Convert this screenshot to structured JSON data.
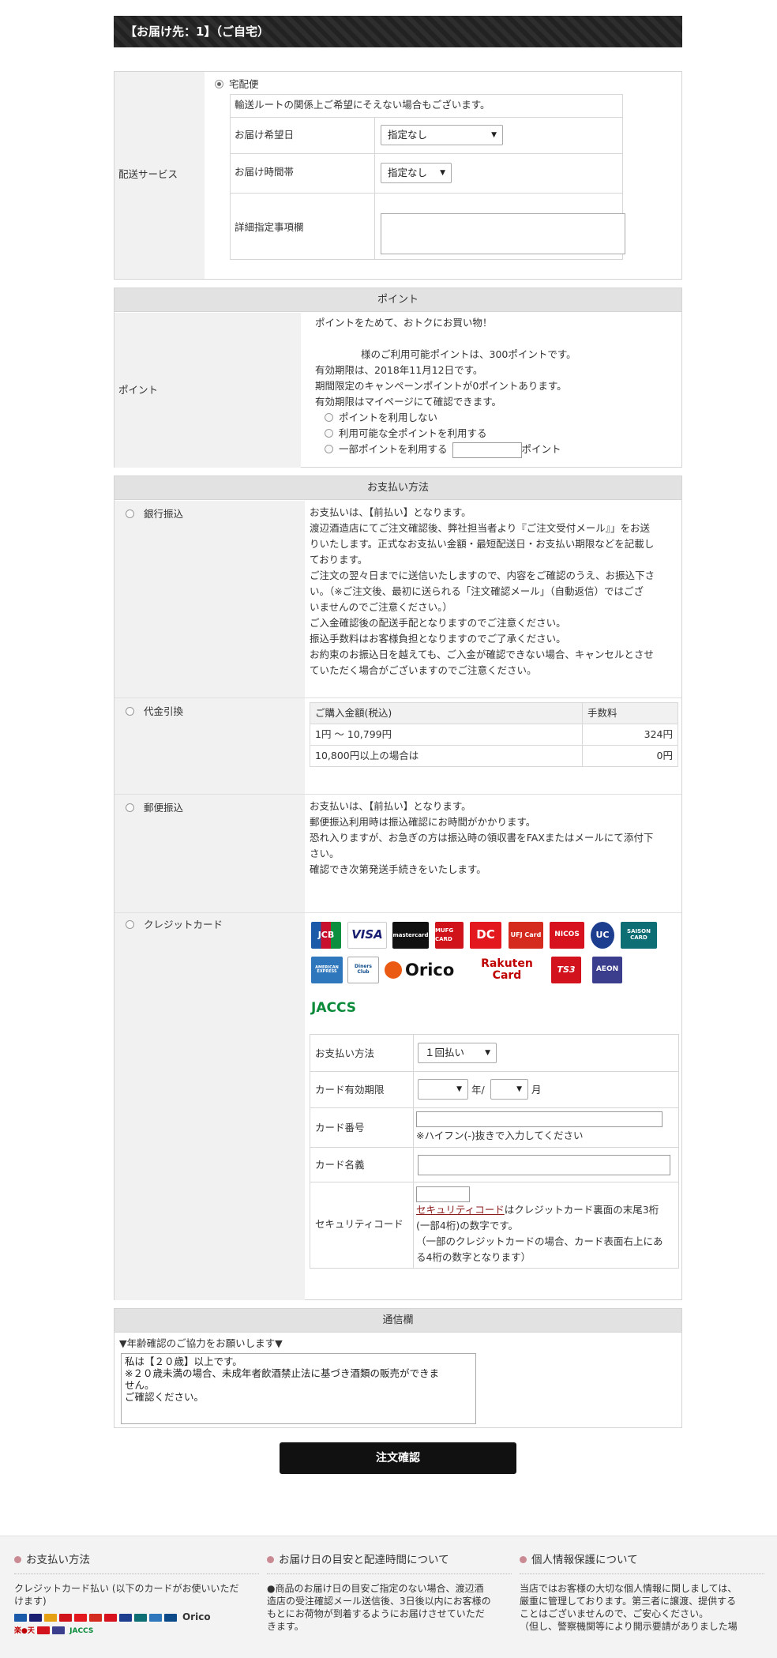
{
  "delivery_header": "【お届け先：1】（ご自宅）",
  "shipping": {
    "label": "配送サービス",
    "option": "宅配便",
    "notice": "輸送ルートの関係上ご希望にそえない場合もございます。",
    "date_label": "お届け希望日",
    "date_value": "指定なし",
    "time_label": "お届け時間帯",
    "time_value": "指定なし",
    "detail_label": "詳細指定事項欄"
  },
  "point": {
    "header": "ポイント",
    "label": "ポイント",
    "line1": "ポイントをためて、おトクにお買い物！",
    "line2": "様のご利用可能ポイントは、300ポイントです。",
    "line3": "有効期限は、2018年11月12日です。",
    "line4": "期間限定のキャンペーンポイントが0ポイントあります。",
    "line5": "有効期限はマイページにて確認できます。",
    "opt_none": "ポイントを利用しない",
    "opt_all": "利用可能な全ポイントを利用する",
    "opt_part": "一部ポイントを利用する",
    "opt_part_unit": "ポイント"
  },
  "payment": {
    "header": "お支払い方法",
    "bank": {
      "label": "銀行振込",
      "lines": [
        "お支払いは、【前払い】となります。",
        "渡辺酒造店にてご注文確認後、弊社担当者より『ご注文受付メール』」をお送",
        "りいたします。正式なお支払い金額・最短配送日・お支払い期限などを記載し",
        "ております。",
        "ご注文の翌々日までに送信いたしますので、内容をご確認のうえ、お振込下さ",
        "い。（※ご注文後、最初に送られる「注文確認メール」（自動返信）ではござ",
        "いませんのでご注意ください。）",
        "ご入金確認後の配送手配となりますのでご注意ください。",
        "振込手数料はお客様負担となりますのでご了承ください。",
        "お約束のお振込日を越えても、ご入金が確認できない場合、キャンセルとさせ",
        "ていただく場合がございますのでご注意ください。"
      ]
    },
    "cod": {
      "label": "代金引換",
      "col1": "ご購入金額(税込)",
      "col2": "手数料",
      "rows": [
        {
          "range": "1円 ～ 10,799円",
          "fee": "324円"
        },
        {
          "range": "10,800円以上の場合は",
          "fee": "0円"
        }
      ]
    },
    "postal": {
      "label": "郵便振込",
      "lines": [
        "お支払いは、【前払い】となります。",
        "郵便振込利用時は振込確認にお時間がかかります。",
        "恐れ入りますが、お急ぎの方は振込時の領収書をFAXまたはメールにて添付下",
        "さい。",
        "確認でき次第発送手続きをいたします。"
      ]
    },
    "credit": {
      "label": "クレジットカード",
      "logos": [
        "JCB",
        "VISA",
        "mastercard",
        "MUFG CARD",
        "DC",
        "UFJ Card",
        "NICOS",
        "UC",
        "SAISON CARD",
        "AMERICAN EXPRESS",
        "Diners Club",
        "Orico",
        "Rakuten Card",
        "TS3",
        "AEON",
        "JACCS"
      ],
      "method_label": "お支払い方法",
      "method_value": "１回払い",
      "expiry_label": "カード有効期限",
      "expiry_year_unit": "年/",
      "expiry_month_unit": "月",
      "number_label": "カード番号",
      "number_note": "※ハイフン(-)抜きで入力してください",
      "name_label": "カード名義",
      "security_label": "セキュリティコード",
      "security_link": "セキュリティコード",
      "security_text1": "はクレジットカード裏面の末尾3桁",
      "security_text2": "(一部4桁)の数字です。",
      "security_text3": "（一部のクレジットカードの場合、カード表面右上にあ",
      "security_text4": "る4桁の数字となります）"
    }
  },
  "message": {
    "header": "通信欄",
    "note": "▼年齢確認のご協力をお願いします▼",
    "text_lines": [
      "私は【２０歳】以上です。",
      "※２０歳未満の場合、未成年者飲酒禁止法に基づき酒類の販売ができま",
      "せん。",
      "ご確認ください。"
    ]
  },
  "confirm_button": "注文確認",
  "footer": {
    "col1_title": "お支払い方法",
    "col1_text1": "クレジットカード払い (以下のカードがお使いいただ",
    "col1_text2": "けます)",
    "col1_logo_orico": "Orico",
    "col1_logo_rakuten": "楽●天",
    "col1_logo_jaccs": "JACCS",
    "col2_title": "お届け日の目安と配達時間について",
    "col2_text": [
      "●商品のお届け日の目安ご指定のない場合、渡辺酒",
      "造店の受注確認メール送信後、3日後以内にお客様の",
      "もとにお荷物が到着するようにお届けさせていただ",
      "きます。"
    ],
    "col3_title": "個人情報保護について",
    "col3_text": [
      "当店ではお客様の大切な個人情報に関しましては、",
      "厳重に管理しております。第三者に譲渡、提供する",
      "ことはございませんので、ご安心ください。",
      "（但し、警察機関等により開示要請がありました場"
    ]
  },
  "colors": {
    "header_dark": "#262626",
    "gray_head": "#e2e2e2",
    "label_bg": "#f1f1f1",
    "link": "#8b1a1a"
  }
}
